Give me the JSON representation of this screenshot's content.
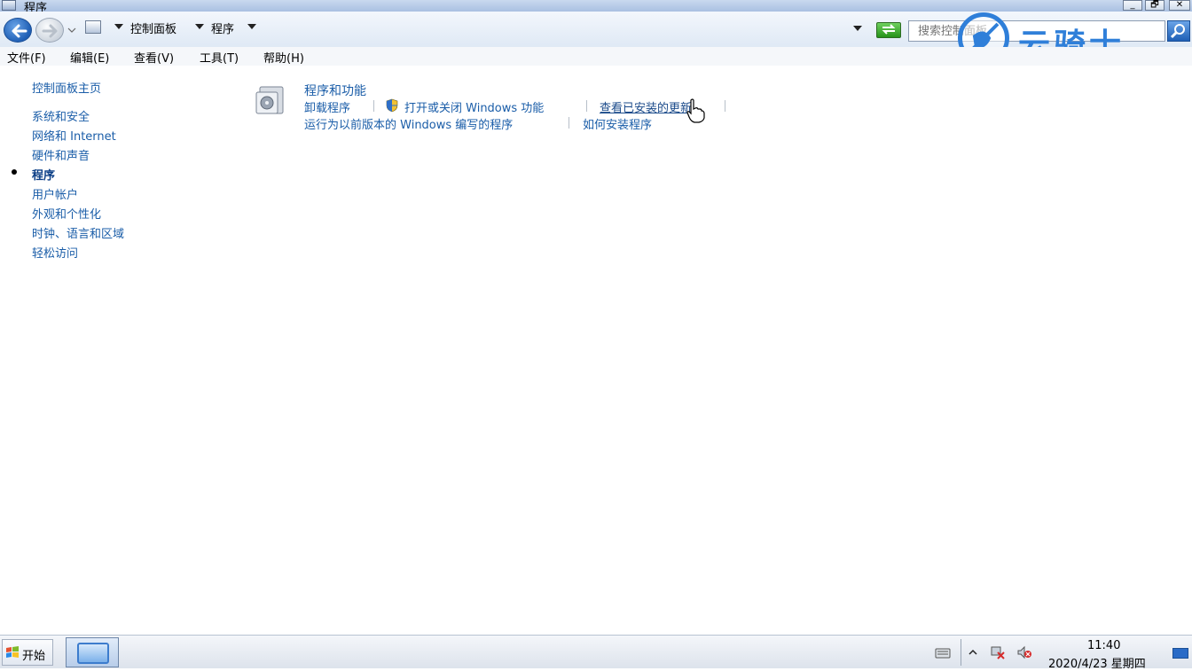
{
  "window": {
    "title": "程序",
    "controls": {
      "minimize": "_",
      "restore": "🗗",
      "close": "✕"
    }
  },
  "address": {
    "crumbs": [
      "控制面板",
      "程序"
    ],
    "search_placeholder": "搜索控制面板"
  },
  "watermark": {
    "text": "云骑士"
  },
  "menu": {
    "items": [
      "文件(F)",
      "编辑(E)",
      "查看(V)",
      "工具(T)",
      "帮助(H)"
    ]
  },
  "sidebar": {
    "home": "控制面板主页",
    "items": [
      "系统和安全",
      "网络和 Internet",
      "硬件和声音",
      "程序",
      "用户帐户",
      "外观和个性化",
      "时钟、语言和区域",
      "轻松访问"
    ],
    "current": "程序"
  },
  "content": {
    "section_title": "程序和功能",
    "tasks_row1": [
      "卸载程序",
      "打开或关闭 Windows 功能",
      "查看已安装的更新"
    ],
    "tasks_row2": [
      "运行为以前版本的 Windows 编写的程序",
      "如何安装程序"
    ]
  },
  "taskbar": {
    "start_label": "开始",
    "clock_time": "11:40",
    "clock_date": "2020/4/23 星期四"
  },
  "colors": {
    "link": "#1a5da8",
    "watermark": "#2f7fd9"
  }
}
